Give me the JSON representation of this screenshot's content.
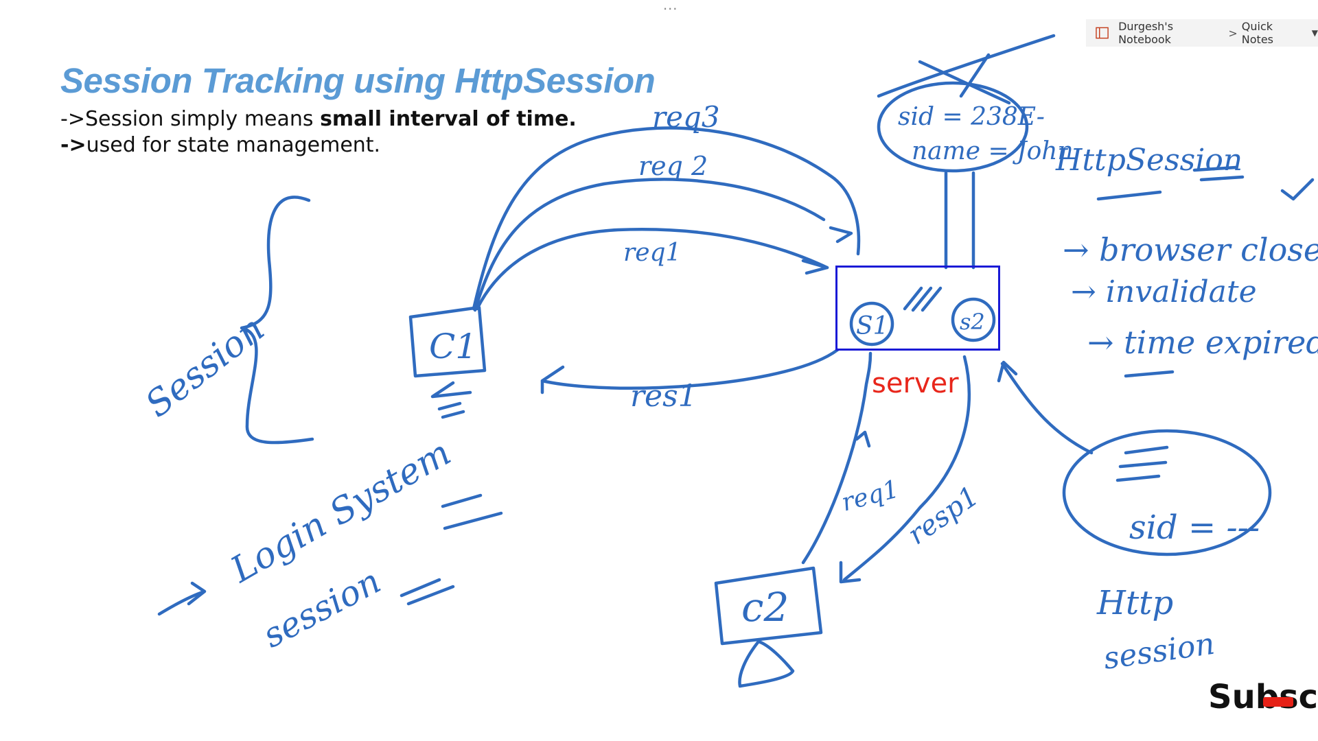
{
  "menu": {
    "dots": "..."
  },
  "breadcrumb": {
    "notebook": "Durgesh's Notebook",
    "separator": ">",
    "section": "Quick Notes"
  },
  "slide": {
    "title": "Session Tracking using HttpSession",
    "line1_prefix": "->Session simply means ",
    "line1_bold": "small interval of time.",
    "line2_prefix": "->",
    "line2_text": "used for state management."
  },
  "server_label": "server",
  "subscribe": "Subscr",
  "colors": {
    "title": "#5b9bd5",
    "ink": "#2f6bbf",
    "server_box": "#1a1ad6",
    "server_label": "#e8261b",
    "youtube": "#e62117"
  },
  "annotations": {
    "req3": "req3",
    "req2": "req 2",
    "req1": "req1",
    "res1": "res1",
    "c1": "C1",
    "c2": "c2",
    "s1": "S1",
    "s2": "s2",
    "sid": "sid = 238E-",
    "name": "name = John",
    "httpsession": "HttpSession",
    "browser_close": "→ browser close",
    "invalidate": "→ invalidate",
    "time_expired": "→ time expired",
    "session_side": "Session",
    "login_system": "Login System",
    "session_login": "session",
    "req1_c2": "req1",
    "resp1_c2": "resp1",
    "sid_cookie": "sid = ---",
    "http_session_bottom_1": "Http",
    "http_session_bottom_2": "session"
  }
}
